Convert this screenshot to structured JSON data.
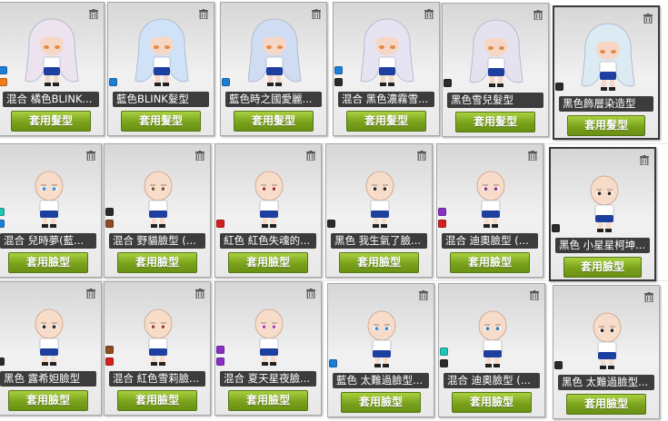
{
  "colors": {
    "blue": "#1c7fd6",
    "orange": "#f07d18",
    "black": "#2b2b2b",
    "teal": "#21c5b6",
    "brown": "#8d4b23",
    "red": "#d3211f",
    "purple": "#8a2fc4"
  },
  "rows": [
    [
      {
        "label": "混合 橘色BLINK...",
        "button": "套用髮型",
        "kind": "hair",
        "hair": "#ece3ee",
        "swatches": [
          "blue",
          "orange"
        ]
      },
      {
        "label": "藍色BLINK髮型",
        "button": "套用髮型",
        "kind": "hair",
        "hair": "#cfe2f7",
        "swatches": [
          "blue"
        ]
      },
      {
        "label": "藍色時之國愛麗...",
        "button": "套用髮型",
        "kind": "hair",
        "hair": "#cfdcf2",
        "swatches": [
          "blue"
        ]
      },
      {
        "label": "混合 黑色濃霧雪...",
        "button": "套用髮型",
        "kind": "hair",
        "hair": "#e6e4f2",
        "swatches": [
          "blue",
          "black"
        ]
      },
      {
        "label": "黑色雪兒髮型",
        "button": "套用髮型",
        "kind": "hair",
        "hair": "#e5e2ef",
        "swatches": [
          "black"
        ]
      },
      {
        "label": "黑色飾層染造型",
        "button": "套用髮型",
        "kind": "hair",
        "hair": "#dceaf3",
        "swatches": [
          "black"
        ]
      }
    ],
    [
      {
        "label": "混合 兒時夢(藍...",
        "button": "套用臉型",
        "kind": "face",
        "eyes": "#3c8fd8",
        "swatches": [
          "teal",
          "blue"
        ]
      },
      {
        "label": "混合 野貓臉型 (...",
        "button": "套用臉型",
        "kind": "face",
        "eyes": "#7a5a2c",
        "swatches": [
          "black",
          "brown"
        ]
      },
      {
        "label": "紅色 紅色失魂的...",
        "button": "套用臉型",
        "kind": "face",
        "eyes": "#b33a2a",
        "swatches": [
          "red"
        ]
      },
      {
        "label": "黑色 我生氣了臉...",
        "button": "套用臉型",
        "kind": "face",
        "eyes": "#3a2a22",
        "swatches": [
          "black"
        ]
      },
      {
        "label": "混合 迪奧臉型 (...",
        "button": "套用臉型",
        "kind": "face",
        "eyes": "#9a3a82",
        "swatches": [
          "purple",
          "red"
        ]
      },
      {
        "label": "黑色 小星星柯坤...",
        "button": "套用臉型",
        "kind": "face",
        "eyes": "#3a2a22",
        "swatches": [
          "black"
        ]
      }
    ],
    [
      {
        "label": "黑色 露希妲臉型",
        "button": "套用臉型",
        "kind": "face",
        "eyes": "#3a2a22",
        "swatches": [
          "black"
        ]
      },
      {
        "label": "混合 紅色雪莉臉...",
        "button": "套用臉型",
        "kind": "face",
        "eyes": "#a8452c",
        "swatches": [
          "brown",
          "red"
        ]
      },
      {
        "label": "混合 夏天星夜臉...",
        "button": "套用臉型",
        "kind": "face",
        "eyes": "#b04aa0",
        "swatches": [
          "purple",
          "purple"
        ]
      },
      {
        "label": "藍色 太難過臉型...",
        "button": "套用臉型",
        "kind": "face",
        "eyes": "#3c8fd8",
        "swatches": [
          "blue"
        ]
      },
      {
        "label": "混合 迪奧臉型 (...",
        "button": "套用臉型",
        "kind": "face",
        "eyes": "#3a7ab0",
        "swatches": [
          "teal",
          "black"
        ]
      },
      {
        "label": "黑色 太難過臉型...",
        "button": "套用臉型",
        "kind": "face",
        "eyes": "#3a2a22",
        "swatches": [
          "black"
        ]
      }
    ]
  ]
}
